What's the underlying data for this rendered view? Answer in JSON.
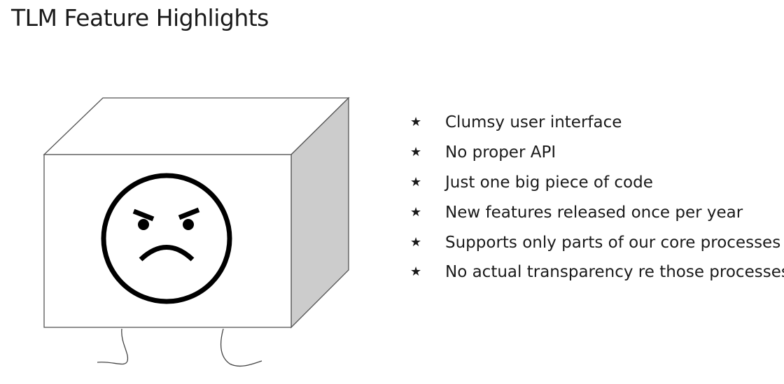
{
  "title": "TLM Feature Highlights",
  "bullet_icon": "star-icon",
  "bullets": [
    "Clumsy user interface",
    "No proper API",
    "Just one big piece of code",
    "New features released once per year",
    "Supports only parts of our core processes",
    "No actual transparency re those processes"
  ],
  "illustration": {
    "subject": "box-character",
    "face": "angry-face-icon",
    "colors": {
      "outline": "#555555",
      "side_face": "#cccccc",
      "front_face": "#ffffff",
      "face_stroke": "#000000"
    }
  }
}
